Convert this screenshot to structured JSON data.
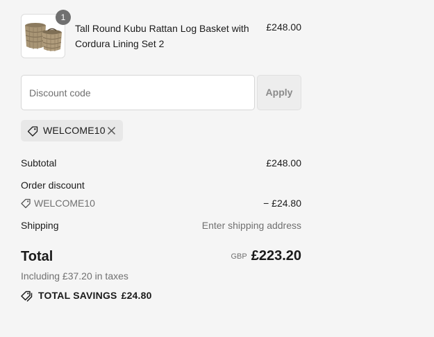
{
  "product": {
    "quantity": "1",
    "name": "Tall Round Kubu Rattan Log Basket with Cordura Lining Set 2",
    "price": "£248.00"
  },
  "discount": {
    "placeholder": "Discount code",
    "apply_label": "Apply",
    "applied_code": "WELCOME10"
  },
  "summary": {
    "subtotal_label": "Subtotal",
    "subtotal_value": "£248.00",
    "order_discount_label": "Order discount",
    "discount_code": "WELCOME10",
    "discount_value": "− £24.80",
    "shipping_label": "Shipping",
    "shipping_value": "Enter shipping address",
    "total_label": "Total",
    "currency": "GBP",
    "total_value": "£223.20",
    "taxes_text": "Including £37.20 in taxes",
    "savings_label": "TOTAL SAVINGS",
    "savings_value": "£24.80"
  },
  "icons": {
    "thumb": "basket-image",
    "tag": "tag-icon",
    "remove": "close-icon",
    "savings": "price-tags-icon"
  }
}
